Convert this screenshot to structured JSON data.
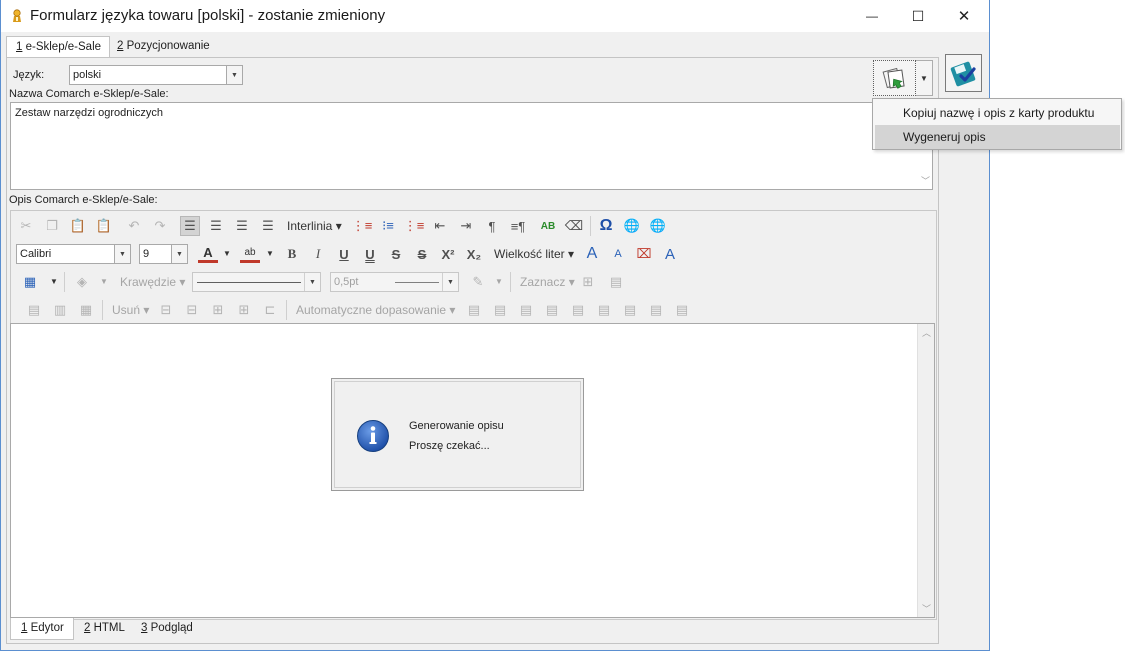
{
  "window": {
    "title": "Formularz języka towaru [polski] - zostanie zmieniony",
    "controls": {
      "minimize": "—",
      "maximize": "☐",
      "close": "✕"
    }
  },
  "tabs": [
    {
      "key": "1",
      "label": " e-Sklep/e-Sale",
      "active": true
    },
    {
      "key": "2",
      "label": " Pozycjonowanie",
      "active": false
    }
  ],
  "form": {
    "language_label": "Język:",
    "language_value": "polski",
    "name_label": "Nazwa Comarch e-Sklep/e-Sale:",
    "name_value": "Zestaw narzędzi ogrodniczych",
    "description_label": "Opis Comarch e-Sklep/e-Sale:"
  },
  "toolbar": {
    "interlinia": "Interlinia",
    "font_name": "Calibri",
    "font_size": "9",
    "font_size_menu": "Wielkość liter",
    "borders": "Krawędzie",
    "line_width": "0,5pt",
    "select": "Zaznacz",
    "remove": "Usuń",
    "autofit": "Automatyczne dopasowanie",
    "ab_glyph": "ab",
    "omega": "Ω"
  },
  "dropdown": {
    "items": [
      {
        "label": "Kopiuj nazwę i opis z karty produktu",
        "highlighted": false
      },
      {
        "label": "Wygeneruj opis",
        "highlighted": true
      }
    ]
  },
  "busy_dialog": {
    "line1": "Generowanie opisu",
    "line2": "Proszę czekać..."
  },
  "editor_tabs": [
    {
      "key": "1",
      "label": " Edytor",
      "active": true
    },
    {
      "key": "2",
      "label": " HTML",
      "active": false
    },
    {
      "key": "3",
      "label": " Podgląd",
      "active": false
    }
  ],
  "colors": {
    "window_border": "#5b8fd0",
    "dialog_bg": "#f0f0f0",
    "menu_highlight": "#d4d4d4",
    "info_blue": "#1e4fa8",
    "save_teal": "#1f8fa3"
  }
}
